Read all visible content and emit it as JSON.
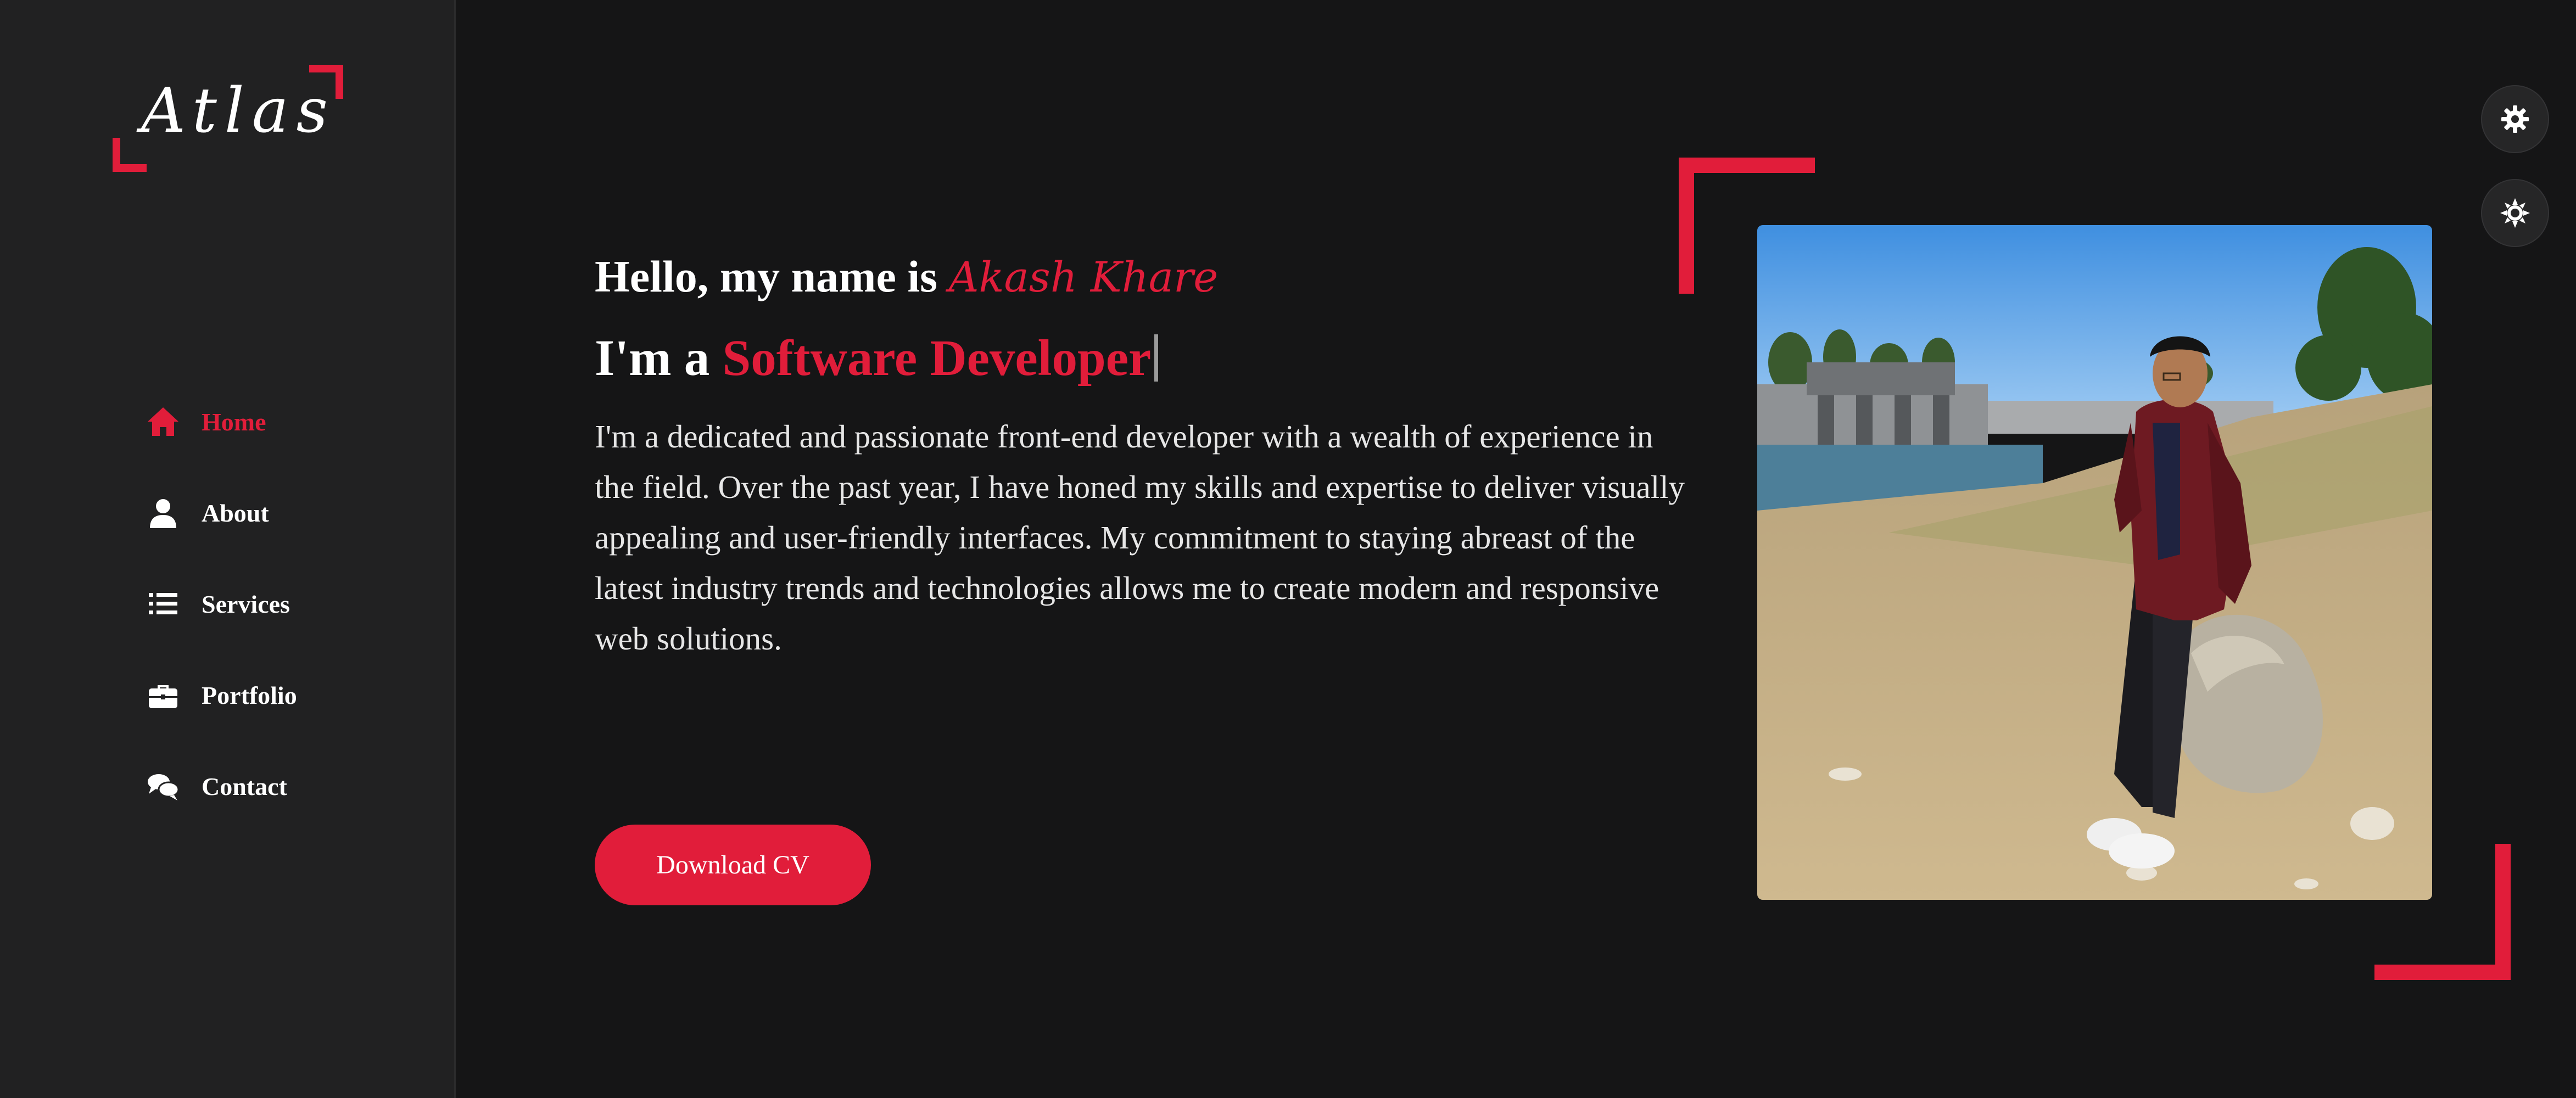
{
  "sidebar": {
    "logo_text": "Atlas",
    "nav": [
      {
        "label": "Home",
        "icon": "home-icon",
        "active": true
      },
      {
        "label": "About",
        "icon": "user-icon",
        "active": false
      },
      {
        "label": "Services",
        "icon": "list-icon",
        "active": false
      },
      {
        "label": "Portfolio",
        "icon": "briefcase-icon",
        "active": false
      },
      {
        "label": "Contact",
        "icon": "comments-icon",
        "active": false
      }
    ]
  },
  "hero": {
    "greeting_prefix": "Hello, my name is ",
    "name": "Akash Khare",
    "role_prefix": "I'm a ",
    "role": "Software Developer",
    "bio": "I'm a dedicated and passionate front-end developer with a wealth of experience in the field. Over the past year, I have honed my skills and expertise to deliver visually appealing and user-friendly interfaces. My commitment to staying abreast of the latest industry trends and technologies allows me to create modern and responsive web solutions.",
    "cta_label": "Download CV"
  },
  "utility": [
    {
      "icon": "gear-icon"
    },
    {
      "icon": "sun-icon"
    }
  ],
  "colors": {
    "accent": "#e11d3a",
    "background": "#151516",
    "sidebar": "#212122",
    "text": "#ffffff"
  }
}
